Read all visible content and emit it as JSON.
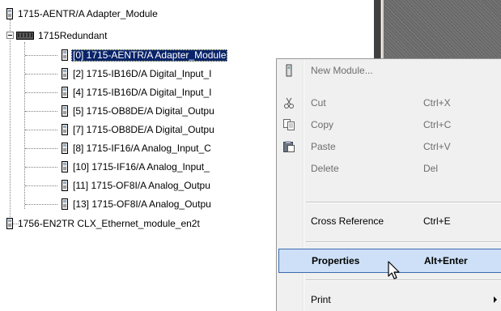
{
  "tree": {
    "items": [
      {
        "label": "1715-AENTR/A Adapter_Module"
      },
      {
        "label": "1715Redundant"
      },
      {
        "label": "[0] 1715-AENTR/A Adapter_Module"
      },
      {
        "label": "[2] 1715-IB16D/A Digital_Input_I"
      },
      {
        "label": "[4] 1715-IB16D/A Digital_Input_I"
      },
      {
        "label": "[5] 1715-OB8DE/A Digital_Outpu"
      },
      {
        "label": "[7] 1715-OB8DE/A Digital_Outpu"
      },
      {
        "label": "[8] 1715-IF16/A Analog_Input_C"
      },
      {
        "label": "[10] 1715-IF16/A Analog_Input_"
      },
      {
        "label": "[11] 1715-OF8I/A Analog_Outpu"
      },
      {
        "label": "[13] 1715-OF8I/A Analog_Outpu"
      },
      {
        "label": "1756-EN2TR CLX_Ethernet_module_en2t"
      }
    ]
  },
  "context_menu": {
    "new_module": {
      "label": "New Module..."
    },
    "cut": {
      "label": "Cut",
      "shortcut": "Ctrl+X"
    },
    "copy": {
      "label": "Copy",
      "shortcut": "Ctrl+C"
    },
    "paste": {
      "label": "Paste",
      "shortcut": "Ctrl+V"
    },
    "delete": {
      "label": "Delete",
      "shortcut": "Del"
    },
    "cross_reference": {
      "label": "Cross Reference",
      "shortcut": "Ctrl+E"
    },
    "properties": {
      "label": "Properties",
      "shortcut": "Alt+Enter"
    },
    "print": {
      "label": "Print"
    }
  },
  "colors": {
    "selection": "#0a246a",
    "menu_highlight": "#cde0f7",
    "menu_highlight_border": "#3c6bb0",
    "disabled_text": "#6d6d6d"
  }
}
